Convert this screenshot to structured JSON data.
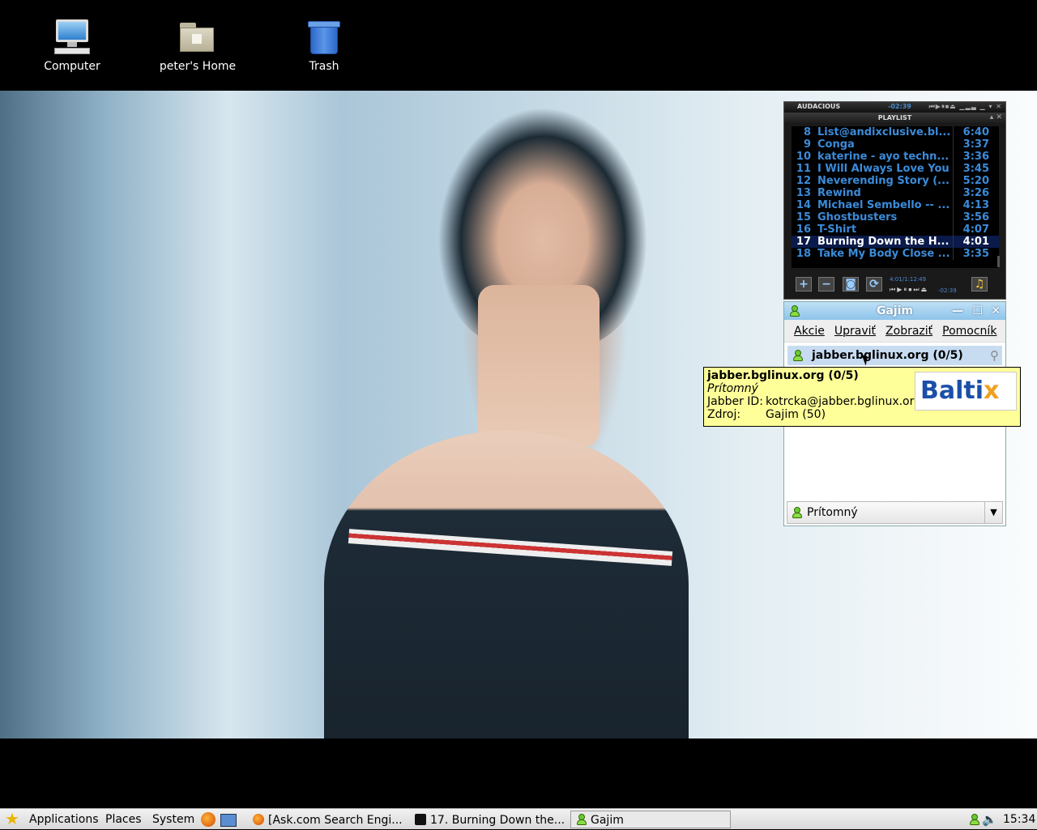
{
  "desktop": {
    "icons": [
      {
        "label": "Computer",
        "icon": "computer-icon"
      },
      {
        "label": "peter's Home",
        "icon": "home-folder-icon"
      },
      {
        "label": "Trash",
        "icon": "trash-icon"
      }
    ]
  },
  "audacious": {
    "title": "AUDACIOUS",
    "mini_time": "-02:39",
    "playlist_title": "PLAYLIST",
    "tracks": [
      {
        "n": "8",
        "title": "List@andixclusive.bl...",
        "dur": "6:40"
      },
      {
        "n": "9",
        "title": "Conga",
        "dur": "3:37"
      },
      {
        "n": "10",
        "title": "katerine - ayo techn...",
        "dur": "3:36"
      },
      {
        "n": "11",
        "title": "I Will Always Love You",
        "dur": "3:45"
      },
      {
        "n": "12",
        "title": "Neverending Story (...",
        "dur": "5:20"
      },
      {
        "n": "13",
        "title": "Rewind",
        "dur": "3:26"
      },
      {
        "n": "14",
        "title": "Michael Sembello -- ...",
        "dur": "4:13"
      },
      {
        "n": "15",
        "title": "Ghostbusters",
        "dur": "3:56"
      },
      {
        "n": "16",
        "title": "T-Shirt",
        "dur": "4:07"
      },
      {
        "n": "17",
        "title": "Burning Down the H...",
        "dur": "4:01"
      },
      {
        "n": "18",
        "title": "Take My Body Close ...",
        "dur": "3:35"
      }
    ],
    "current_track": "17",
    "time_info": "4:01/1:12:49",
    "remaining": "-02:39",
    "buttons": {
      "add": "+",
      "remove": "−",
      "select": "◙",
      "misc": "⟳"
    }
  },
  "gajim": {
    "title": "Gajim",
    "menu": [
      "Akcie",
      "Upraviť",
      "Zobraziť",
      "Pomocník"
    ],
    "account": "jabber.bglinux.org (0/5)",
    "status": "Prítomný",
    "tooltip": {
      "account": "jabber.bglinux.org (0/5)",
      "status": "Prítomný",
      "jid_label": "Jabber ID:",
      "jid": "kotrcka@jabber.bglinux.org",
      "resource_label": "Zdroj:",
      "resource": "Gajim (50)",
      "logo_text": "Baltix"
    }
  },
  "taskbar": {
    "menus": [
      "Applications",
      "Places",
      "System"
    ],
    "tasks": [
      {
        "label": "[Ask.com Search Engi...",
        "icon": "firefox-icon"
      },
      {
        "label": "17. Burning Down the...",
        "icon": "audacious-icon"
      },
      {
        "label": "Gajim",
        "icon": "gajim-icon"
      }
    ],
    "clock": "15:34"
  }
}
